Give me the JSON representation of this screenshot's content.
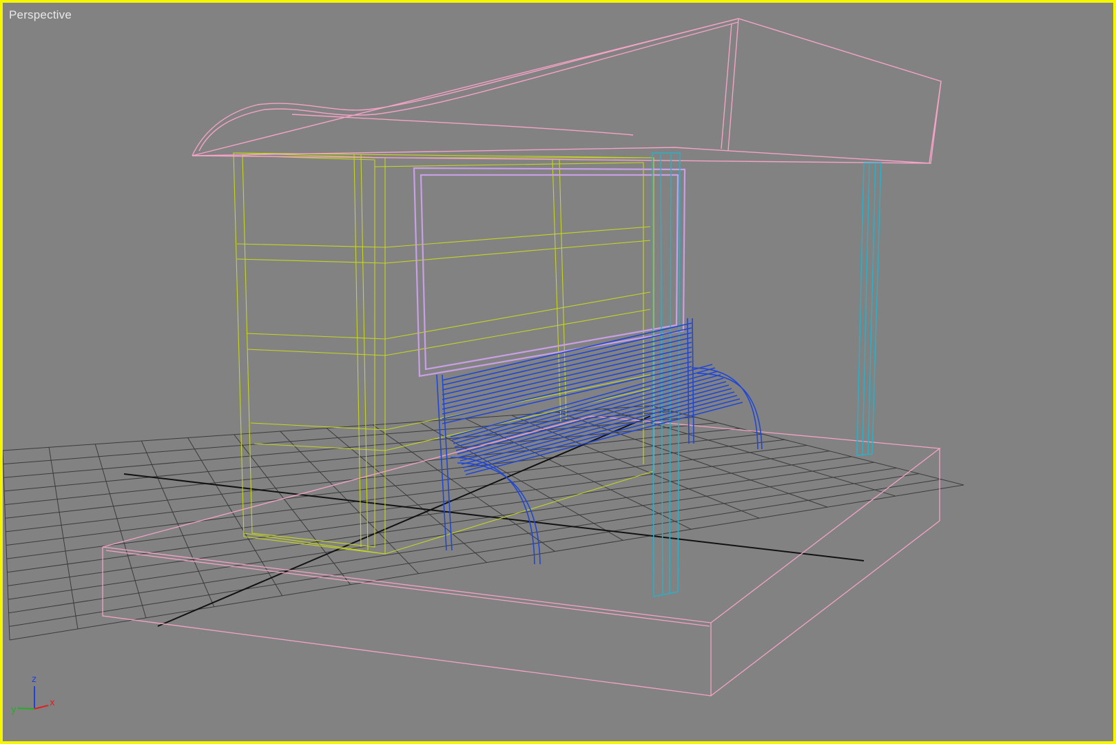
{
  "viewport": {
    "label": "Perspective",
    "border_color": "#f5f500",
    "background_color": "#828282"
  },
  "scene_objects": [
    {
      "name": "roof",
      "wire_color": "#f5a3c6"
    },
    {
      "name": "platform",
      "wire_color": "#f5a3c6"
    },
    {
      "name": "glass-panels",
      "wire_color": "#c6d61e"
    },
    {
      "name": "billboard-frame",
      "wire_color": "#c9a0e8"
    },
    {
      "name": "bench",
      "wire_color": "#1f47d6"
    },
    {
      "name": "support-posts",
      "wire_color": "#2ab0c8"
    },
    {
      "name": "home-grid",
      "wire_color": "#3a3a3a"
    }
  ],
  "axis_gizmo": {
    "z_label": "z",
    "x_label": "x",
    "y_label": "y",
    "z_color": "#2040e0",
    "x_color": "#e02020",
    "y_color": "#20b020"
  }
}
